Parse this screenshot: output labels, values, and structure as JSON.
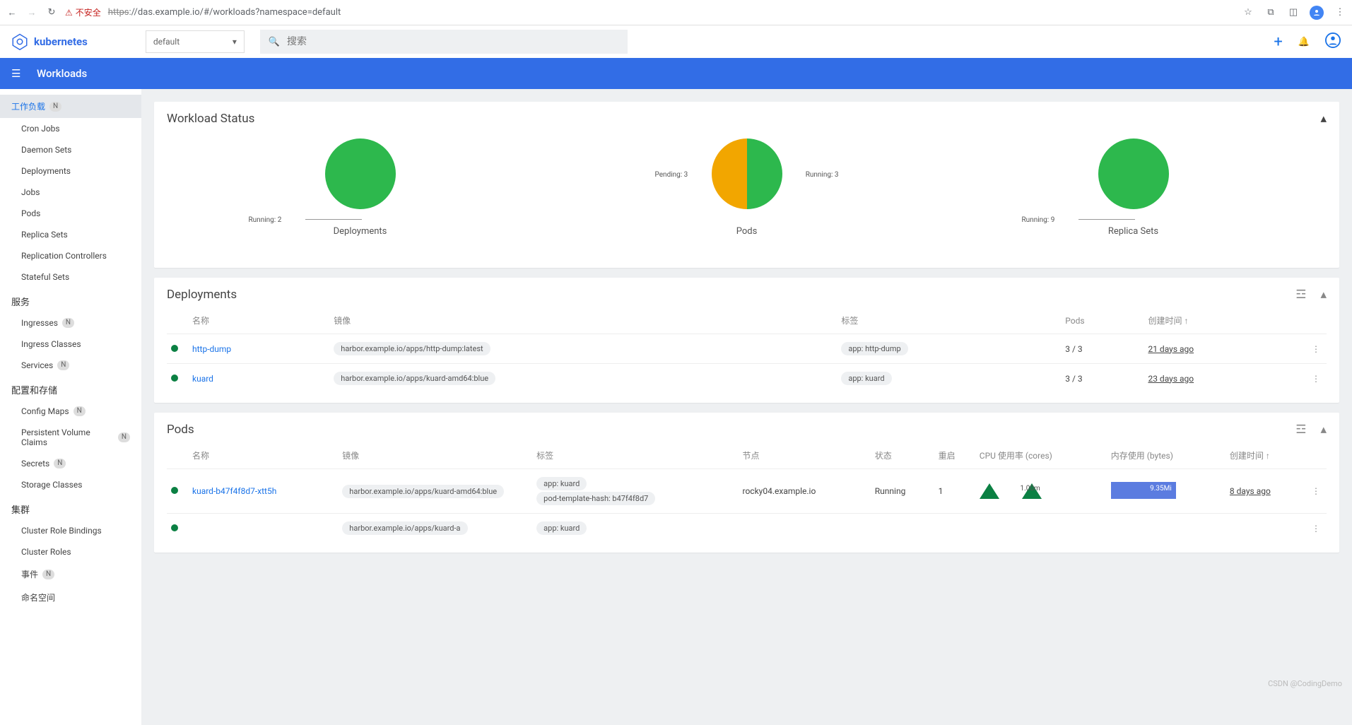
{
  "browser": {
    "insecure_label": "不安全",
    "url_scheme": "https",
    "url_rest": "://das.example.io/#/workloads?namespace=default"
  },
  "app": {
    "brand": "kubernetes",
    "namespace_selected": "default",
    "search_placeholder": "搜索",
    "page_title": "Workloads"
  },
  "sidebar": {
    "workloads": {
      "label": "工作负载",
      "items": [
        "Cron Jobs",
        "Daemon Sets",
        "Deployments",
        "Jobs",
        "Pods",
        "Replica Sets",
        "Replication Controllers",
        "Stateful Sets"
      ]
    },
    "services": {
      "label": "服务",
      "items": [
        [
          "Ingresses",
          "N"
        ],
        [
          "Ingress Classes",
          ""
        ],
        [
          "Services",
          "N"
        ]
      ]
    },
    "config": {
      "label": "配置和存储",
      "items": [
        [
          "Config Maps",
          "N"
        ],
        [
          "Persistent Volume Claims",
          "N"
        ],
        [
          "Secrets",
          "N"
        ],
        [
          "Storage Classes",
          ""
        ]
      ]
    },
    "cluster": {
      "label": "集群",
      "items": [
        [
          "Cluster Role Bindings",
          ""
        ],
        [
          "Cluster Roles",
          ""
        ],
        [
          "事件",
          "N"
        ],
        [
          "命名空间",
          ""
        ]
      ]
    }
  },
  "status": {
    "title": "Workload Status",
    "charts": [
      {
        "title": "Deployments",
        "running": 2,
        "pending": 0,
        "annot_right": "",
        "annot_left": "Running: 2"
      },
      {
        "title": "Pods",
        "running": 3,
        "pending": 3,
        "annot_right": "Running: 3",
        "annot_left": "Pending: 3"
      },
      {
        "title": "Replica Sets",
        "running": 9,
        "pending": 0,
        "annot_right": "",
        "annot_left": "Running: 9"
      }
    ]
  },
  "deployments": {
    "title": "Deployments",
    "cols": [
      "名称",
      "镜像",
      "标签",
      "Pods",
      "创建时间"
    ],
    "rows": [
      {
        "name": "http-dump",
        "image": "harbor.example.io/apps/http-dump:latest",
        "labels": [
          "app: http-dump"
        ],
        "pods": "3 / 3",
        "age": "21 days ago"
      },
      {
        "name": "kuard",
        "image": "harbor.example.io/apps/kuard-amd64:blue",
        "labels": [
          "app: kuard"
        ],
        "pods": "3 / 3",
        "age": "23 days ago"
      }
    ]
  },
  "pods": {
    "title": "Pods",
    "cols": [
      "名称",
      "镜像",
      "标签",
      "节点",
      "状态",
      "重启",
      "CPU 使用率 (cores)",
      "内存使用 (bytes)",
      "创建时间"
    ],
    "rows": [
      {
        "name": "kuard-b47f4f8d7-xtt5h",
        "image": "harbor.example.io/apps/kuard-amd64:blue",
        "labels": [
          "app: kuard",
          "pod-template-hash: b47f4f8d7"
        ],
        "node": "rocky04.example.io",
        "status": "Running",
        "restarts": "1",
        "cpu": "1.00m",
        "mem": "9.35Mi",
        "age": "8 days ago"
      },
      {
        "name": "",
        "image": "harbor.example.io/apps/kuard-a",
        "labels": [
          "app: kuard"
        ],
        "node": "",
        "status": "",
        "restarts": "",
        "cpu": "",
        "mem": "",
        "age": ""
      }
    ]
  },
  "chart_data": [
    {
      "type": "pie",
      "title": "Deployments",
      "series": [
        {
          "name": "Running",
          "value": 2
        }
      ],
      "colors": {
        "Running": "#2db84d"
      }
    },
    {
      "type": "pie",
      "title": "Pods",
      "series": [
        {
          "name": "Pending",
          "value": 3
        },
        {
          "name": "Running",
          "value": 3
        }
      ],
      "colors": {
        "Pending": "#f2a600",
        "Running": "#2db84d"
      }
    },
    {
      "type": "pie",
      "title": "Replica Sets",
      "series": [
        {
          "name": "Running",
          "value": 9
        }
      ],
      "colors": {
        "Running": "#2db84d"
      }
    }
  ],
  "watermark": "CSDN @CodingDemo"
}
